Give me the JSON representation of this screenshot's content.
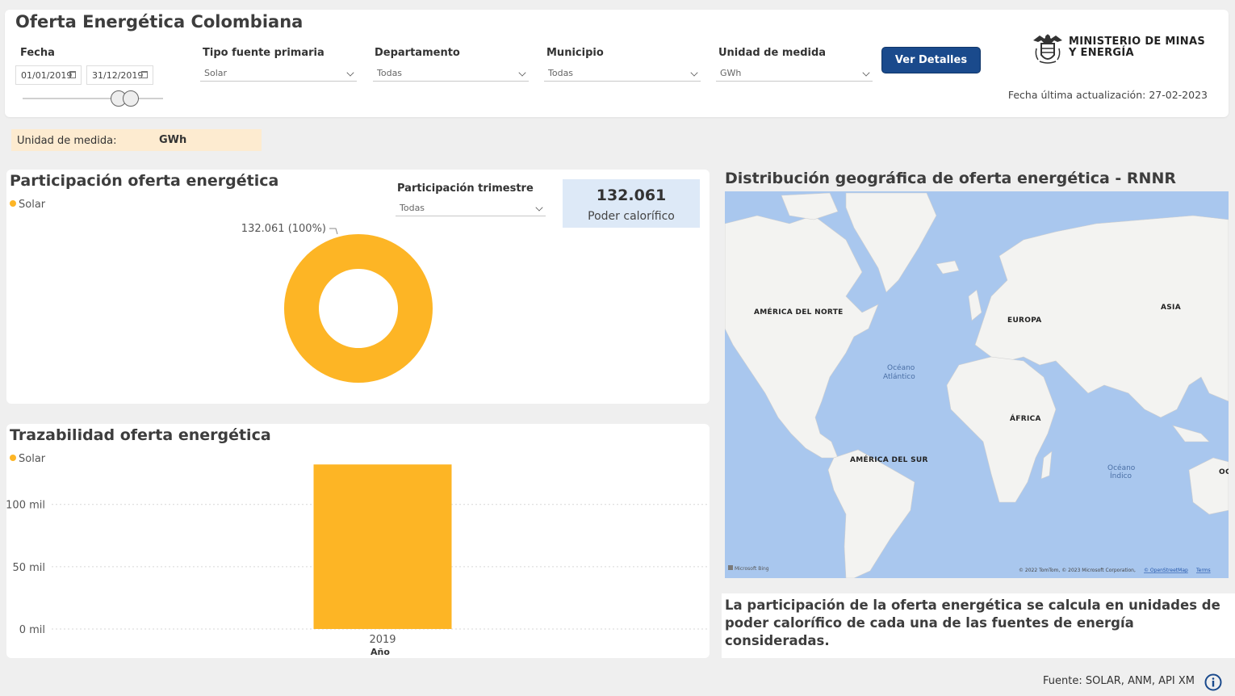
{
  "header": {
    "title": "Oferta Energética Colombiana",
    "ministry_name": "MINISTERIO DE MINAS\nY ENERGÍA",
    "last_update_label": "Fecha última actualización:",
    "last_update_value": "27-02-2023",
    "details_button": "Ver Detalles"
  },
  "filters": {
    "date_label": "Fecha",
    "date_start": "01/01/2019",
    "date_end": "31/12/2019",
    "source_type_label": "Tipo fuente primaria",
    "source_type_value": "Solar",
    "department_label": "Departamento",
    "department_value": "Todas",
    "municipality_label": "Municipio",
    "municipality_value": "Todas",
    "unit_label": "Unidad de medida",
    "unit_value": "GWh"
  },
  "unit_banner": {
    "label": "Unidad de medida:",
    "value": "GWh"
  },
  "participation": {
    "title": "Participación oferta energética",
    "legend": "Solar",
    "quarter_label": "Participación trimestre",
    "quarter_value": "Todas",
    "kpi_value": "132.061",
    "kpi_caption": "Poder calorífico"
  },
  "traceability": {
    "title": "Trazabilidad oferta energética",
    "legend": "Solar"
  },
  "map": {
    "title": "Distribución geográfica de oferta energética - RNNR",
    "labels": {
      "north_america": "AMÉRICA DEL NORTE",
      "south_america": "AMÉRICA DEL SUR",
      "europe": "EUROPA",
      "africa": "ÁFRICA",
      "asia": "ASIA",
      "oceania_cut": "OC",
      "atlantic_1": "Océano",
      "atlantic_2": "Atlántico",
      "indian_1": "Océano",
      "indian_2": "Índico"
    },
    "bing_label": "Microsoft Bing",
    "copyright": "© 2022 TomTom, © 2023 Microsoft Corporation,",
    "osm_link": "© OpenStreetMap",
    "terms_link": "Terms"
  },
  "note": {
    "text": "La participación de la oferta energética se calcula en unidades de poder calorífico de cada una de las fuentes de energía consideradas."
  },
  "footer": {
    "source_text": "Fuente:  SOLAR, ANM,  API XM"
  },
  "colors": {
    "solar": "#fdb525",
    "button": "#1a4a8c",
    "kpi_bg": "#dde9f7",
    "banner_bg": "#fdebd0",
    "ocean": "#a9c7ee",
    "land": "#f3f3f1"
  },
  "chart_data": [
    {
      "type": "pie",
      "variant": "donut",
      "categories": [
        "Solar"
      ],
      "values": [
        132061
      ],
      "data_labels": [
        "132.061 (100%)"
      ],
      "legend": [
        "Solar"
      ],
      "legend_placement": "top-left"
    },
    {
      "type": "bar",
      "categories": [
        "2019"
      ],
      "series": [
        {
          "name": "Solar",
          "values": [
            132061
          ]
        }
      ],
      "xlabel": "Año",
      "ylabel": "",
      "ylim": [
        0,
        140000
      ],
      "yticks": [
        0,
        50000,
        100000
      ],
      "ytick_labels": [
        "0 mil",
        "50 mil",
        "100 mil"
      ],
      "grid": true,
      "legend_placement": "top-left"
    }
  ]
}
